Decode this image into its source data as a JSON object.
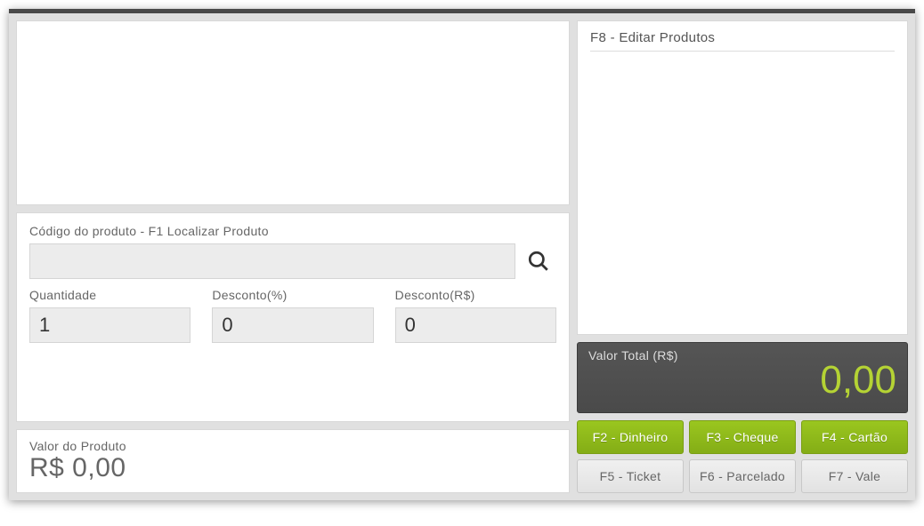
{
  "left": {
    "codigo_label": "Código do produto - F1 Localizar Produto",
    "codigo_value": "",
    "quantidade_label": "Quantidade",
    "quantidade_value": "1",
    "desconto_pct_label": "Desconto(%)",
    "desconto_pct_value": "0",
    "desconto_rs_label": "Desconto(R$)",
    "desconto_rs_value": "0",
    "valor_produto_label": "Valor do Produto",
    "valor_produto_value": "R$ 0,00"
  },
  "right": {
    "editar_label": "F8 - Editar Produtos",
    "total_label": "Valor Total (R$)",
    "total_value": "0,00",
    "buttons": {
      "f2": "F2 - Dinheiro",
      "f3": "F3 - Cheque",
      "f4": "F4 - Cartão",
      "f5": "F5 - Ticket",
      "f6": "F6 - Parcelado",
      "f7": "F7 - Vale"
    }
  }
}
